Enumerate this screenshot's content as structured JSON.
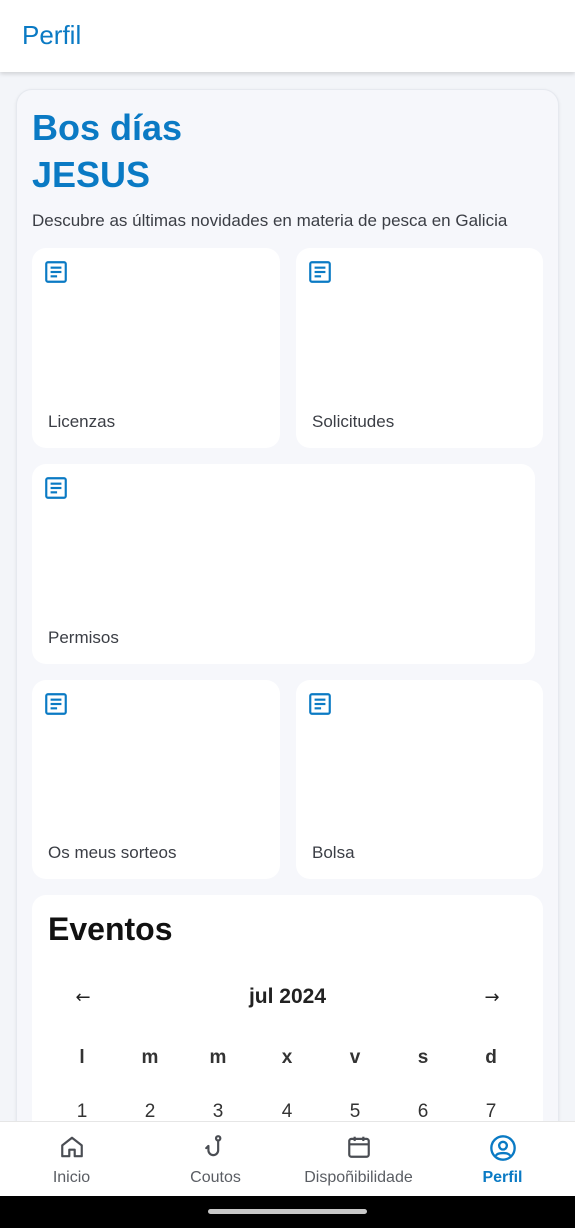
{
  "header": {
    "title": "Perfil"
  },
  "greeting": {
    "line1": "Bos días",
    "line2": "JESUS"
  },
  "subtitle": "Descubre as últimas novidades en materia de pesca en Galicia",
  "tiles": [
    {
      "label": "Licenzas",
      "icon": "document-icon"
    },
    {
      "label": "Solicitudes",
      "icon": "document-icon"
    },
    {
      "label": "Permisos",
      "icon": "document-icon"
    },
    {
      "label": "Os meus sorteos",
      "icon": "document-icon"
    },
    {
      "label": "Bolsa",
      "icon": "document-icon"
    }
  ],
  "events": {
    "title": "Eventos",
    "month": "jul 2024",
    "prev": "←",
    "next": "→",
    "weekdays": [
      "l",
      "m",
      "m",
      "x",
      "v",
      "s",
      "d"
    ],
    "days": [
      "1",
      "2",
      "3",
      "4",
      "5",
      "6",
      "7"
    ]
  },
  "nav": [
    {
      "label": "Inicio",
      "icon": "home-icon"
    },
    {
      "label": "Coutos",
      "icon": "fishing-hook-icon"
    },
    {
      "label": "Dispoñibilidade",
      "icon": "calendar-icon"
    },
    {
      "label": "Perfil",
      "icon": "account-circle-icon",
      "active": true
    }
  ],
  "colors": {
    "accent": "#0a7ac4",
    "text": "#3b3e45",
    "background": "#f3f5f9",
    "card": "#ffffff"
  }
}
